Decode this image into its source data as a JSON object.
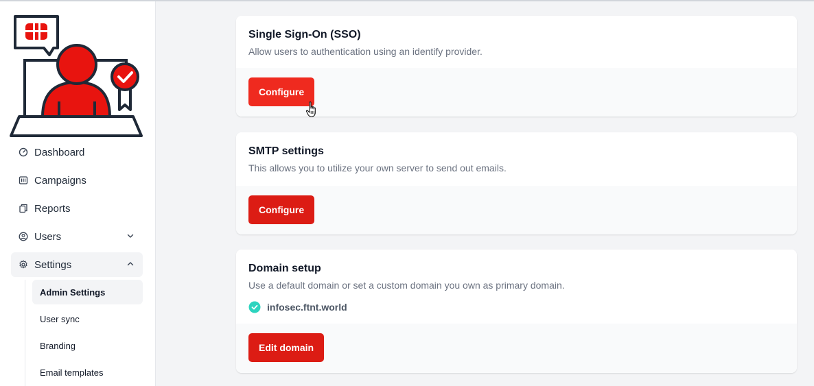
{
  "sidebar": {
    "items": [
      {
        "label": "Dashboard",
        "icon": "gauge-icon"
      },
      {
        "label": "Campaigns",
        "icon": "campaign-icon"
      },
      {
        "label": "Reports",
        "icon": "reports-icon"
      },
      {
        "label": "Users",
        "icon": "user-circle-icon"
      },
      {
        "label": "Settings",
        "icon": "gear-icon"
      }
    ],
    "subitems": [
      {
        "label": "Admin Settings",
        "active": true
      },
      {
        "label": "User sync"
      },
      {
        "label": "Branding"
      },
      {
        "label": "Email templates"
      }
    ]
  },
  "cards": {
    "sso": {
      "title": "Single Sign-On (SSO)",
      "description": "Allow users to authentication using an identify provider.",
      "button": "Configure"
    },
    "smtp": {
      "title": "SMTP settings",
      "description": "This allows you to utilize your own server to send out emails.",
      "button": "Configure"
    },
    "domain": {
      "title": "Domain setup",
      "description": "Use a default domain or set a custom domain you own as primary domain.",
      "domain_value": "infosec.ftnt.world",
      "button": "Edit domain"
    }
  },
  "colors": {
    "accent": "#dc1c14",
    "accent_hover": "#ef2a1f",
    "verified": "#2dd4bf"
  }
}
